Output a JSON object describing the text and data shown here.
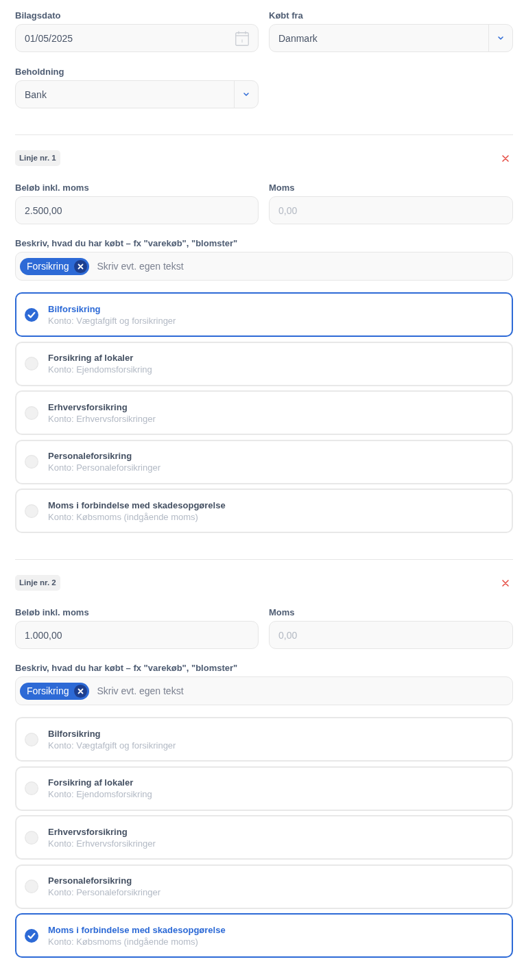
{
  "fields": [
    {
      "kind": "date",
      "label": "Bilagsdato",
      "value": "01/05/2025"
    },
    {
      "kind": "select",
      "label": "Købt fra",
      "value": "Danmark"
    },
    {
      "kind": "select",
      "label": "Beholdning",
      "value": "Bank"
    }
  ],
  "lines": [
    {
      "badge": "Linje nr. 1",
      "fields": [
        {
          "label": "Beløb inkl. moms",
          "value": "2.500,00",
          "disabled": false
        },
        {
          "label": "Moms",
          "value": "0,00",
          "disabled": true
        }
      ],
      "description": {
        "label": "Beskriv, hvad du har købt – fx \"varekøb\", \"blomster\"",
        "tags": [
          "Forsikring"
        ],
        "placeholder": "Skriv evt. egen tekst"
      },
      "options": [
        {
          "title": "Bilforsikring",
          "account": "Konto: Vægtafgift og forsikringer",
          "selected": true
        },
        {
          "title": "Forsikring af lokaler",
          "account": "Konto: Ejendomsforsikring",
          "selected": false
        },
        {
          "title": "Erhvervsforsikring",
          "account": "Konto: Erhvervsforsikringer",
          "selected": false
        },
        {
          "title": "Personaleforsikring",
          "account": "Konto: Personaleforsikringer",
          "selected": false
        },
        {
          "title": "Moms i forbindelse med skadesopgørelse",
          "account": "Konto: Købsmoms (indgående moms)",
          "selected": false
        }
      ]
    },
    {
      "badge": "Linje nr. 2",
      "fields": [
        {
          "label": "Beløb inkl. moms",
          "value": "1.000,00",
          "disabled": false
        },
        {
          "label": "Moms",
          "value": "0,00",
          "disabled": true
        }
      ],
      "description": {
        "label": "Beskriv, hvad du har købt – fx \"varekøb\", \"blomster\"",
        "tags": [
          "Forsikring"
        ],
        "placeholder": "Skriv evt. egen tekst"
      },
      "options": [
        {
          "title": "Bilforsikring",
          "account": "Konto: Vægtafgift og forsikringer",
          "selected": false
        },
        {
          "title": "Forsikring af lokaler",
          "account": "Konto: Ejendomsforsikring",
          "selected": false
        },
        {
          "title": "Erhvervsforsikring",
          "account": "Konto: Erhvervsforsikringer",
          "selected": false
        },
        {
          "title": "Personaleforsikring",
          "account": "Konto: Personaleforsikringer",
          "selected": false
        },
        {
          "title": "Moms i forbindelse med skadesopgørelse",
          "account": "Konto: Købsmoms (indgående moms)",
          "selected": true
        }
      ]
    }
  ]
}
